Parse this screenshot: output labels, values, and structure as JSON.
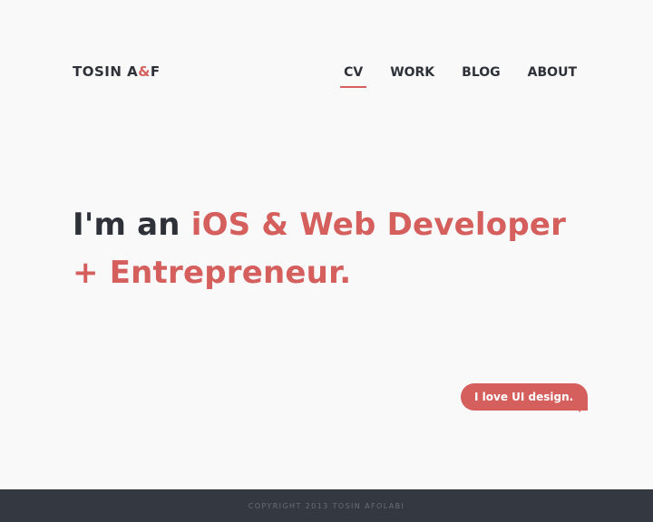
{
  "header": {
    "logo_left": "TOSIN A",
    "logo_amp": "&",
    "logo_right": "F"
  },
  "nav": {
    "items": [
      {
        "label": "CV",
        "active": true
      },
      {
        "label": "WORK",
        "active": false
      },
      {
        "label": "BLOG",
        "active": false
      },
      {
        "label": "ABOUT",
        "active": false
      }
    ]
  },
  "hero": {
    "intro": "I'm an ",
    "highlight": "iOS & Web Developer + Entrepreneur."
  },
  "bubble": {
    "text": "I love UI design."
  },
  "footer": {
    "copyright": "COPYRIGHT 2013 TOSIN AFOLABI"
  },
  "colors": {
    "accent": "#d45f5c",
    "text_dark": "#2e3138",
    "background": "#f9f9fa",
    "footer_bg": "#343841",
    "footer_text": "#6a6e77"
  }
}
